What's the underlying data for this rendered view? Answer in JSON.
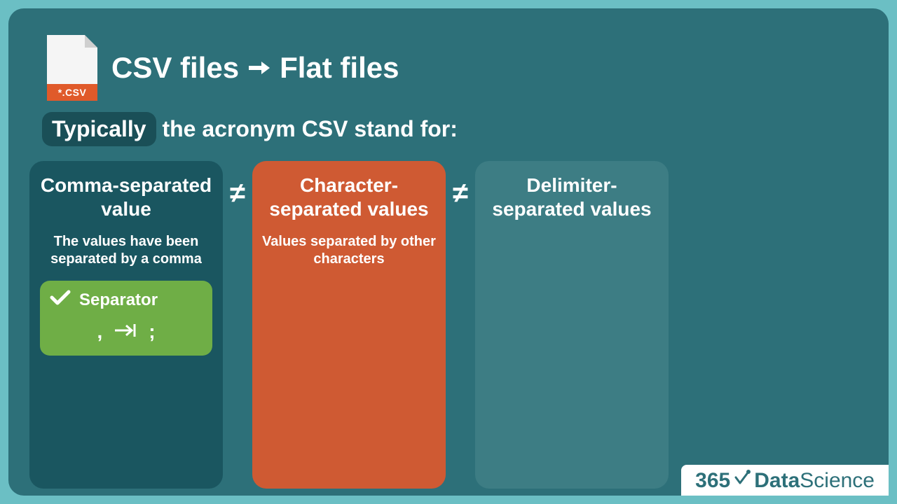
{
  "header": {
    "file_extension": "*.CSV",
    "title_left": "CSV files",
    "title_right": "Flat files"
  },
  "subtitle": {
    "pill": "Typically",
    "rest": " the acronym CSV stand for:"
  },
  "neq_symbol": "≠",
  "cards": [
    {
      "title": "Comma-separated value",
      "desc": "The values have been separated by a comma",
      "separator": {
        "label": "Separator",
        "chars": {
          "comma": ",",
          "semicolon": ";"
        }
      }
    },
    {
      "title": "Character-separated values",
      "desc": "Values separated by other characters"
    },
    {
      "title": "Delimiter-separated values",
      "desc": ""
    }
  ],
  "logo": {
    "prefix": "365",
    "word1": "Data",
    "word2": "Science"
  }
}
